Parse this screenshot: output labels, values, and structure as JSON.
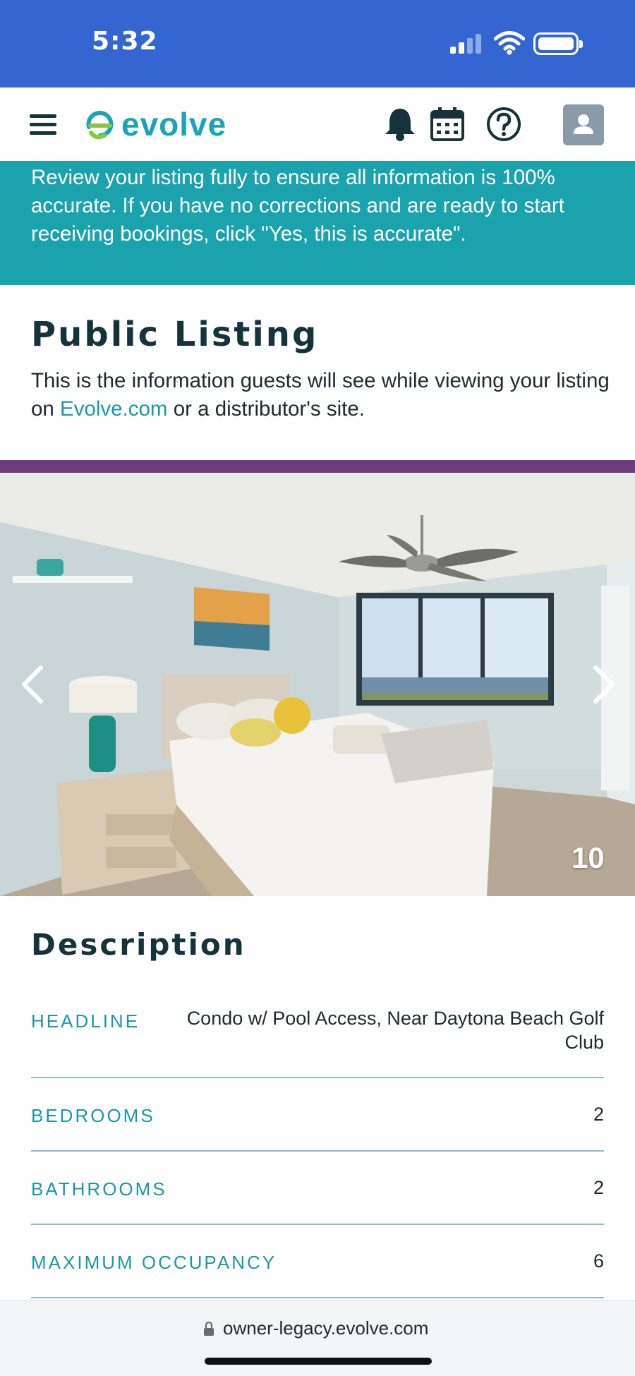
{
  "status_bar": {
    "time": "5:32"
  },
  "header": {
    "logo_text": "evolve",
    "icons": [
      "bell-icon",
      "calendar-icon",
      "help-icon",
      "user-avatar-icon"
    ],
    "brand_color": "#1aa4b5"
  },
  "banner": {
    "text": "Review your listing fully to ensure all information is 100% accurate. If you have no corrections and are ready to start receiving bookings, click \"Yes, this is accurate\".",
    "background": "#1aa3ad"
  },
  "public_listing": {
    "title": "Public Listing",
    "desc_before": "This is the information guests will see while viewing your listing on ",
    "desc_link": "Evolve.com",
    "desc_after": " or a distributor's site."
  },
  "carousel": {
    "photo_number": "10"
  },
  "description": {
    "title": "Description",
    "rows": [
      {
        "label": "HEADLINE",
        "value": "Condo w/ Pool Access, Near Daytona Beach Golf Club"
      },
      {
        "label": "BEDROOMS",
        "value": "2"
      },
      {
        "label": "BATHROOMS",
        "value": "2"
      },
      {
        "label": "MAXIMUM OCCUPANCY",
        "value": "6"
      }
    ]
  },
  "browser": {
    "url": "owner-legacy.evolve.com"
  }
}
